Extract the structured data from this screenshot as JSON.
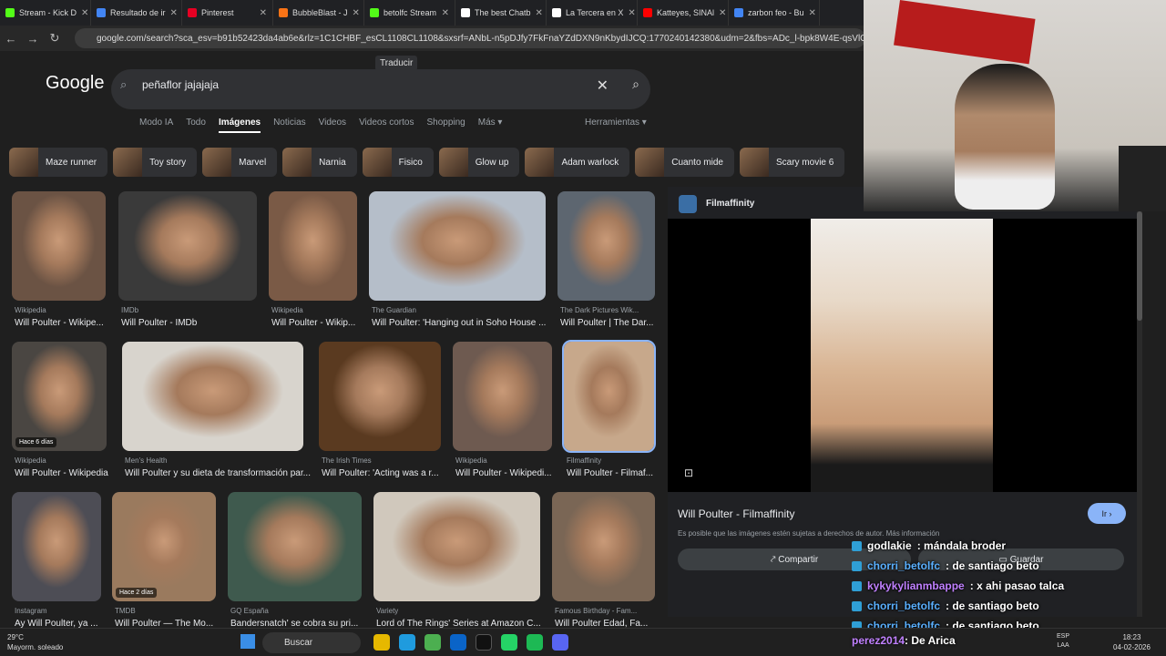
{
  "tabs": [
    {
      "label": "Stream - Kick D",
      "color": "#53fc18"
    },
    {
      "label": "Resultado de ir",
      "color": "#4285f4"
    },
    {
      "label": "Pinterest",
      "color": "#e60023"
    },
    {
      "label": "BubbleBlast - J",
      "color": "#f97316"
    },
    {
      "label": "betolfc Stream",
      "color": "#53fc18"
    },
    {
      "label": "The best Chatb",
      "color": "#ffffff"
    },
    {
      "label": "La Tercera en X",
      "color": "#ffffff"
    },
    {
      "label": "Katteyes, SINAl",
      "color": "#ff0000"
    },
    {
      "label": "zarbon feo - Bu",
      "color": "#4285f4"
    }
  ],
  "url": "google.com/search?sca_esv=b91b52423da4ab6e&rlz=1C1CHBF_esCL1108CL1108&sxsrf=ANbL-n5pDJfy7FkFnaYZdDXN9nKbydIJCQ:1770240142380&udm=2&fbs=ADc_l-bpk8W4E-qsVlOvbGJcDwpn60Dcz",
  "logo": "Google",
  "translate": "Traducir",
  "search": {
    "query": "peñaflor jajajaja"
  },
  "filter_tabs": [
    "Modo IA",
    "Todo",
    "Imágenes",
    "Noticias",
    "Videos",
    "Videos cortos",
    "Shopping",
    "Más ▾"
  ],
  "tools": "Herramientas ▾",
  "chips": [
    "Maze runner",
    "Toy story",
    "Marvel",
    "Narnia",
    "Fisico",
    "Glow up",
    "Adam warlock",
    "Cuanto mide",
    "Scary movie 6"
  ],
  "results": [
    {
      "src": "Wikipedia",
      "title": "Will Poulter - Wikipe..."
    },
    {
      "src": "IMDb",
      "title": "Will Poulter - IMDb"
    },
    {
      "src": "Wikipedia",
      "title": "Will Poulter - Wikip..."
    },
    {
      "src": "The Guardian",
      "title": "Will Poulter: 'Hanging out in Soho House ..."
    },
    {
      "src": "The Dark Pictures Wik...",
      "title": "Will Poulter | The Dar..."
    },
    {
      "src": "Wikipedia",
      "title": "Will Poulter - Wikipedia",
      "badge": "Hace 6 días"
    },
    {
      "src": "Men's Health",
      "title": "Will Poulter y su dieta de transformación par..."
    },
    {
      "src": "The Irish Times",
      "title": "Will Poulter: 'Acting was a r..."
    },
    {
      "src": "Wikipedia",
      "title": "Will Poulter - Wikipedi..."
    },
    {
      "src": "Filmaffinity",
      "title": "Will Poulter - Filmaf..."
    },
    {
      "src": "Instagram",
      "title": "Ay Will Poulter, ya ..."
    },
    {
      "src": "TMDB",
      "title": "Will Poulter — The Mo...",
      "badge": "Hace 2 días"
    },
    {
      "src": "GQ España",
      "title": "Bandersnatch' se cobra su pri..."
    },
    {
      "src": "Variety",
      "title": "Lord of The Rings' Series at Amazon C..."
    },
    {
      "src": "Famous Birthday - Fam...",
      "title": "Will Poulter Edad, Fa..."
    }
  ],
  "panel": {
    "source": "Filmaffinity",
    "title": "Will Poulter - Filmaffinity",
    "go": "Ir ›",
    "note": "Es posible que las imágenes estén sujetas a derechos de autor. Más información",
    "share": "Compartir",
    "save": "Guardar"
  },
  "chat": [
    {
      "user": "godlakie",
      "msg": ": mándala broder",
      "color": "#ffffff"
    },
    {
      "user": "chorri_betolfc",
      "msg": ": de santiago beto",
      "color": "#5ab0ff"
    },
    {
      "user": "kykykylianmbappe",
      "msg": ": x ahi pasao talca",
      "color": "#c080ff"
    },
    {
      "user": "chorri_betolfc",
      "msg": ": de santiago beto",
      "color": "#5ab0ff"
    },
    {
      "user": "chorri_betolfc",
      "msg": ": de santiago beto",
      "color": "#5ab0ff"
    },
    {
      "user": "perez2014",
      "msg": ": De Arica",
      "color": "#c080ff"
    }
  ],
  "taskbar": {
    "temp": "29°C",
    "weather": "Mayorm. soleado",
    "search": "Buscar",
    "lang1": "ESP",
    "lang2": "LAA",
    "time": "18:23",
    "date": "04-02-2026"
  }
}
